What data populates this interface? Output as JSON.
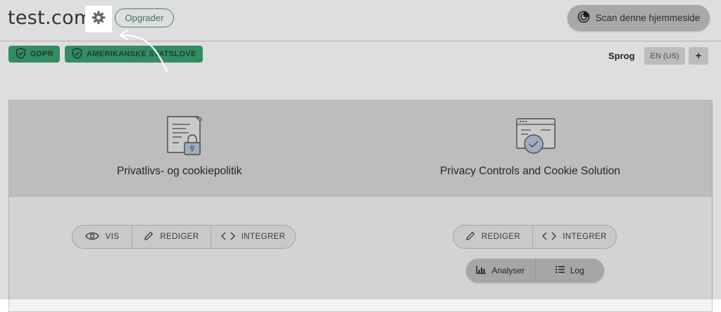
{
  "header": {
    "site_title": "test.com",
    "upgrade_label": "Opgrader",
    "scan_label": "Scan denne hjemmeside"
  },
  "badges": [
    {
      "label": "GDPR",
      "icon": "shield-check-icon"
    },
    {
      "label": "AMERIKANSKE STATSLOVE",
      "icon": "shield-check-icon"
    }
  ],
  "language": {
    "label": "Sprog",
    "current": "EN (US)",
    "add_label": "+"
  },
  "columns": [
    {
      "title": "Privatlivs- og cookiepolitik",
      "icon": "policy-document-lock-icon",
      "actions": [
        {
          "label": "VIS",
          "icon": "eye-icon"
        },
        {
          "label": "REDIGER",
          "icon": "pencil-icon"
        },
        {
          "label": "INTEGRER",
          "icon": "code-icon"
        }
      ]
    },
    {
      "title": "Privacy Controls and Cookie Solution",
      "icon": "browser-cookie-icon",
      "actions": [
        {
          "label": "REDIGER",
          "icon": "pencil-icon"
        },
        {
          "label": "INTEGRER",
          "icon": "code-icon"
        }
      ],
      "secondary_actions": [
        {
          "label": "Analyser",
          "icon": "bar-chart-icon"
        },
        {
          "label": "Log",
          "icon": "list-icon"
        }
      ]
    }
  ],
  "colors": {
    "accent_green": "#3ca36f",
    "overlay": "rgba(0,0,0,0.13)"
  }
}
